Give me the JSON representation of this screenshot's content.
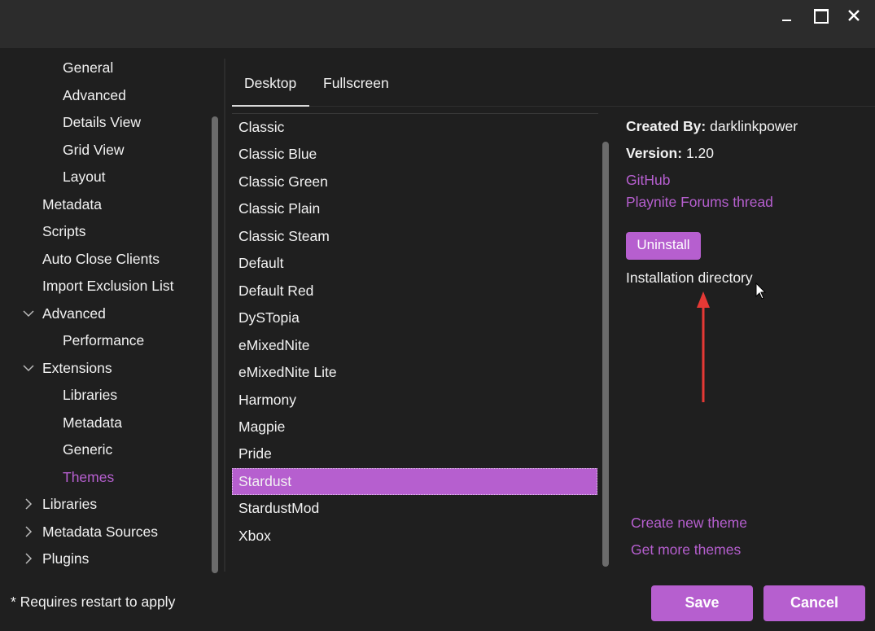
{
  "sidebar": {
    "items": [
      {
        "label": "General"
      },
      {
        "label": "Advanced"
      },
      {
        "label": "Details View"
      },
      {
        "label": "Grid View"
      },
      {
        "label": "Layout"
      },
      {
        "label": "Metadata"
      },
      {
        "label": "Scripts"
      },
      {
        "label": "Auto Close Clients"
      },
      {
        "label": "Import Exclusion List"
      },
      {
        "label": "Advanced"
      },
      {
        "label": "Performance"
      },
      {
        "label": "Extensions"
      },
      {
        "label": "Libraries"
      },
      {
        "label": "Metadata"
      },
      {
        "label": "Generic"
      },
      {
        "label": "Themes"
      },
      {
        "label": "Libraries"
      },
      {
        "label": "Metadata Sources"
      },
      {
        "label": "Plugins"
      }
    ]
  },
  "tabs": [
    {
      "label": "Desktop"
    },
    {
      "label": "Fullscreen"
    }
  ],
  "themes": [
    "Classic",
    "Classic Blue",
    "Classic Green",
    "Classic Plain",
    "Classic Steam",
    "Default",
    "Default Red",
    "DySTopia",
    "eMixedNite",
    "eMixedNite Lite",
    "Harmony",
    "Magpie",
    "Pride",
    "Stardust",
    "StardustMod",
    "Xbox"
  ],
  "selected_theme": "Stardust",
  "details": {
    "created_by_label": "Created By:",
    "created_by": "darklinkpower",
    "version_label": "Version:",
    "version": "1.20",
    "github_link": "GitHub",
    "forum_link": "Playnite Forums thread",
    "uninstall_label": "Uninstall",
    "install_dir_label": "Installation directory"
  },
  "links": {
    "create_theme": "Create new theme",
    "more_themes": "Get more themes"
  },
  "footer": {
    "note": "* Requires restart to apply",
    "save": "Save",
    "cancel": "Cancel"
  },
  "colors": {
    "accent": "#b65fcf",
    "background": "#1f1f1f",
    "titlebar": "#2c2c2c",
    "annotation_arrow": "#e53935"
  },
  "icons": {
    "minimize": "minimize-icon",
    "maximize": "maximize-icon",
    "close": "close-icon",
    "chevron_down": "chevron-down-icon",
    "chevron_right": "chevron-right-icon"
  }
}
